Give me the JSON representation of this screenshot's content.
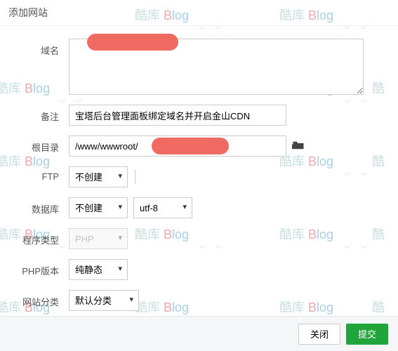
{
  "title": "添加网站",
  "watermark": {
    "ku": "酷库 ",
    "b": "B",
    "log": "log"
  },
  "labels": {
    "domain": "域名",
    "note": "备注",
    "root": "根目录",
    "ftp": "FTP",
    "db": "数据库",
    "program": "程序类型",
    "php": "PHP版本",
    "category": "网站分类"
  },
  "values": {
    "note": "宝塔后台管理面板绑定域名并开启金山CDN",
    "root": "/www/wwwroot/",
    "ftp": "不创建",
    "db": "不创建",
    "db_charset": "utf-8",
    "program": "PHP",
    "php": "纯静态",
    "category": "默认分类"
  },
  "buttons": {
    "close": "关闭",
    "submit": "提交"
  }
}
